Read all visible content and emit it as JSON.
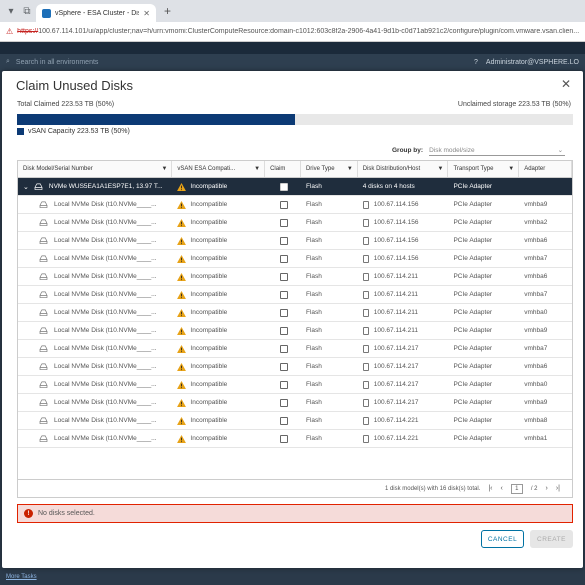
{
  "browser": {
    "tab_title": "vSphere - ESA Cluster - Disk Ma...",
    "url_scheme": "https://",
    "url_rest": "100.67.114.101/ui/app/cluster;nav=h/urn:vmomi:ClusterComputeResource:domain-c1012:603c8f2a-2906-4a41-9d1b-c0d71ab921c2/configure/plugin/com.vmware.vsan.clien..."
  },
  "vsphere": {
    "search_placeholder": "Search in all environments",
    "user": "Administrator@VSPHERE.LO"
  },
  "modal": {
    "title": "Claim Unused Disks",
    "total_claimed": "Total Claimed 223.53 TB (50%)",
    "unclaimed": "Unclaimed storage 223.53 TB (50%)",
    "claimed_fraction": 0.5,
    "legend_label": "vSAN Capacity 223.53 TB (50%)",
    "group_by_label": "Group by:",
    "group_by_value": "Disk model/size",
    "columns": [
      "Disk Model/Serial Number",
      "vSAN ESA Compati...",
      "Claim",
      "Drive Type",
      "Disk Distribution/Host",
      "Transport Type",
      "Adapter"
    ],
    "parent_row": {
      "model": "NVMe WUS5EA1A1ESP7E1, 13.97 T...",
      "compat": "Incompatible",
      "drive_type": "Flash",
      "distribution": "4 disks on 4 hosts",
      "transport": "PCIe Adapter",
      "adapter": ""
    },
    "rows": [
      {
        "model": "Local NVMe Disk (t10.NVMe____...",
        "compat": "Incompatible",
        "drive_type": "Flash",
        "host": "100.67.114.156",
        "transport": "PCIe Adapter",
        "adapter": "vmhba9"
      },
      {
        "model": "Local NVMe Disk (t10.NVMe____...",
        "compat": "Incompatible",
        "drive_type": "Flash",
        "host": "100.67.114.156",
        "transport": "PCIe Adapter",
        "adapter": "vmhba2"
      },
      {
        "model": "Local NVMe Disk (t10.NVMe____...",
        "compat": "Incompatible",
        "drive_type": "Flash",
        "host": "100.67.114.156",
        "transport": "PCIe Adapter",
        "adapter": "vmhba6"
      },
      {
        "model": "Local NVMe Disk (t10.NVMe____...",
        "compat": "Incompatible",
        "drive_type": "Flash",
        "host": "100.67.114.156",
        "transport": "PCIe Adapter",
        "adapter": "vmhba7"
      },
      {
        "model": "Local NVMe Disk (t10.NVMe____...",
        "compat": "Incompatible",
        "drive_type": "Flash",
        "host": "100.67.114.211",
        "transport": "PCIe Adapter",
        "adapter": "vmhba6"
      },
      {
        "model": "Local NVMe Disk (t10.NVMe____...",
        "compat": "Incompatible",
        "drive_type": "Flash",
        "host": "100.67.114.211",
        "transport": "PCIe Adapter",
        "adapter": "vmhba7"
      },
      {
        "model": "Local NVMe Disk (t10.NVMe____...",
        "compat": "Incompatible",
        "drive_type": "Flash",
        "host": "100.67.114.211",
        "transport": "PCIe Adapter",
        "adapter": "vmhba0"
      },
      {
        "model": "Local NVMe Disk (t10.NVMe____...",
        "compat": "Incompatible",
        "drive_type": "Flash",
        "host": "100.67.114.211",
        "transport": "PCIe Adapter",
        "adapter": "vmhba9"
      },
      {
        "model": "Local NVMe Disk (t10.NVMe____...",
        "compat": "Incompatible",
        "drive_type": "Flash",
        "host": "100.67.114.217",
        "transport": "PCIe Adapter",
        "adapter": "vmhba7"
      },
      {
        "model": "Local NVMe Disk (t10.NVMe____...",
        "compat": "Incompatible",
        "drive_type": "Flash",
        "host": "100.67.114.217",
        "transport": "PCIe Adapter",
        "adapter": "vmhba6"
      },
      {
        "model": "Local NVMe Disk (t10.NVMe____...",
        "compat": "Incompatible",
        "drive_type": "Flash",
        "host": "100.67.114.217",
        "transport": "PCIe Adapter",
        "adapter": "vmhba0"
      },
      {
        "model": "Local NVMe Disk (t10.NVMe____...",
        "compat": "Incompatible",
        "drive_type": "Flash",
        "host": "100.67.114.217",
        "transport": "PCIe Adapter",
        "adapter": "vmhba9"
      },
      {
        "model": "Local NVMe Disk (t10.NVMe____...",
        "compat": "Incompatible",
        "drive_type": "Flash",
        "host": "100.67.114.221",
        "transport": "PCIe Adapter",
        "adapter": "vmhba8"
      },
      {
        "model": "Local NVMe Disk (t10.NVMe____...",
        "compat": "Incompatible",
        "drive_type": "Flash",
        "host": "100.67.114.221",
        "transport": "PCIe Adapter",
        "adapter": "vmhba1"
      }
    ],
    "footer_summary": "1 disk model(s) with 16 disk(s) total.",
    "page_current": "1",
    "page_total": "/ 2",
    "alert": "No disks selected.",
    "cancel_label": "CANCEL",
    "create_label": "CREATE"
  },
  "bottom_link": "More Tasks",
  "colors": {
    "primary": "#0c3a75",
    "parent_row": "#1f2d3d",
    "warn": "#e8a317",
    "error": "#c92100",
    "link": "#0072a3"
  }
}
